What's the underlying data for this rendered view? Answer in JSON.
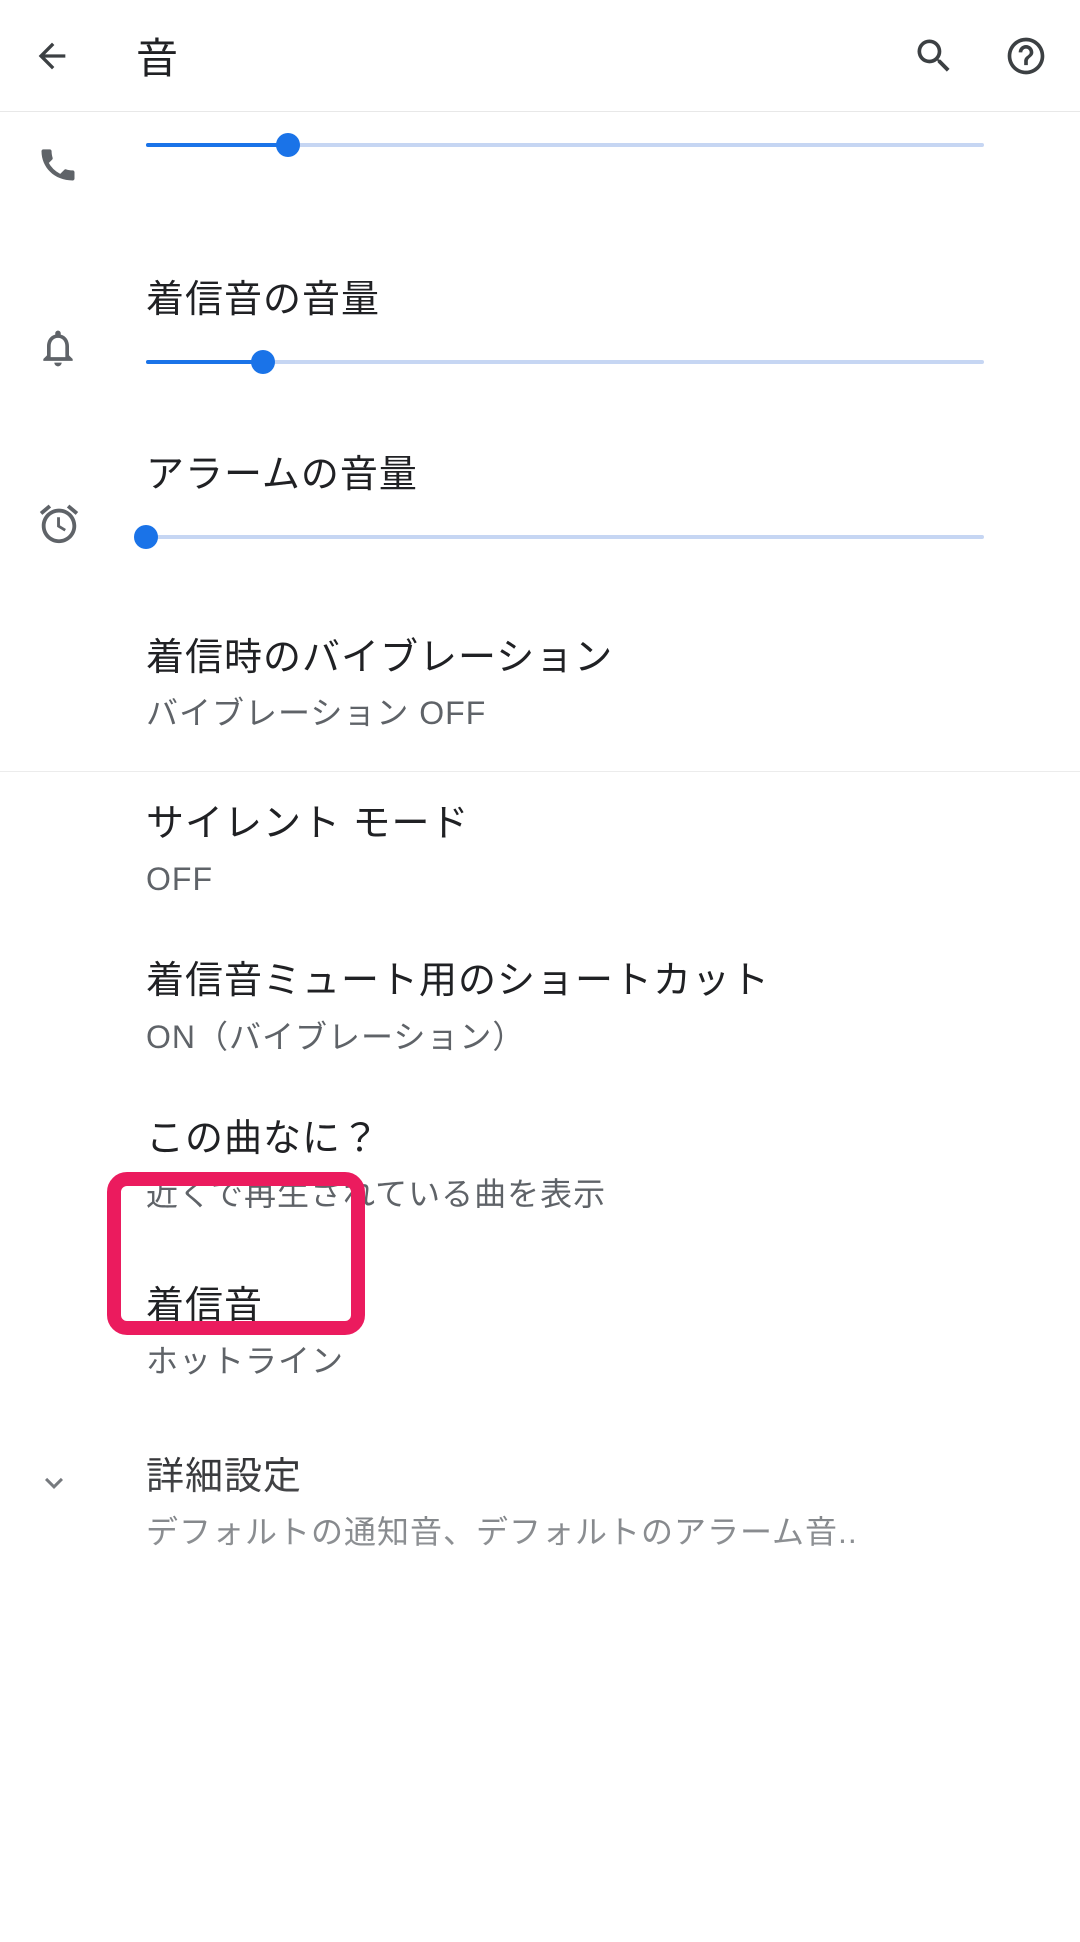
{
  "header": {
    "title": "音"
  },
  "sliders": {
    "call": {
      "percent": 17
    },
    "ring": {
      "label": "着信音の音量",
      "percent": 14
    },
    "alarm": {
      "label": "アラームの音量",
      "percent": 0
    }
  },
  "settings": {
    "vibrate": {
      "title": "着信時のバイブレーション",
      "sub": "バイブレーション OFF"
    },
    "silent": {
      "title": "サイレント モード",
      "sub": "OFF"
    },
    "shortcut": {
      "title": "着信音ミュート用のショートカット",
      "sub": "ON（バイブレーション）"
    },
    "nowplaying": {
      "title": "この曲なに？",
      "sub": "近くで再生されている曲を表示"
    },
    "ringtone": {
      "title": "着信音",
      "sub": "ホットライン"
    },
    "advanced": {
      "title": "詳細設定",
      "sub": "デフォルトの通知音、デフォルトのアラーム音.."
    }
  },
  "colors": {
    "accent": "#1a73e8",
    "highlight": "#eb1b5e",
    "textSecondary": "#5f6368"
  }
}
